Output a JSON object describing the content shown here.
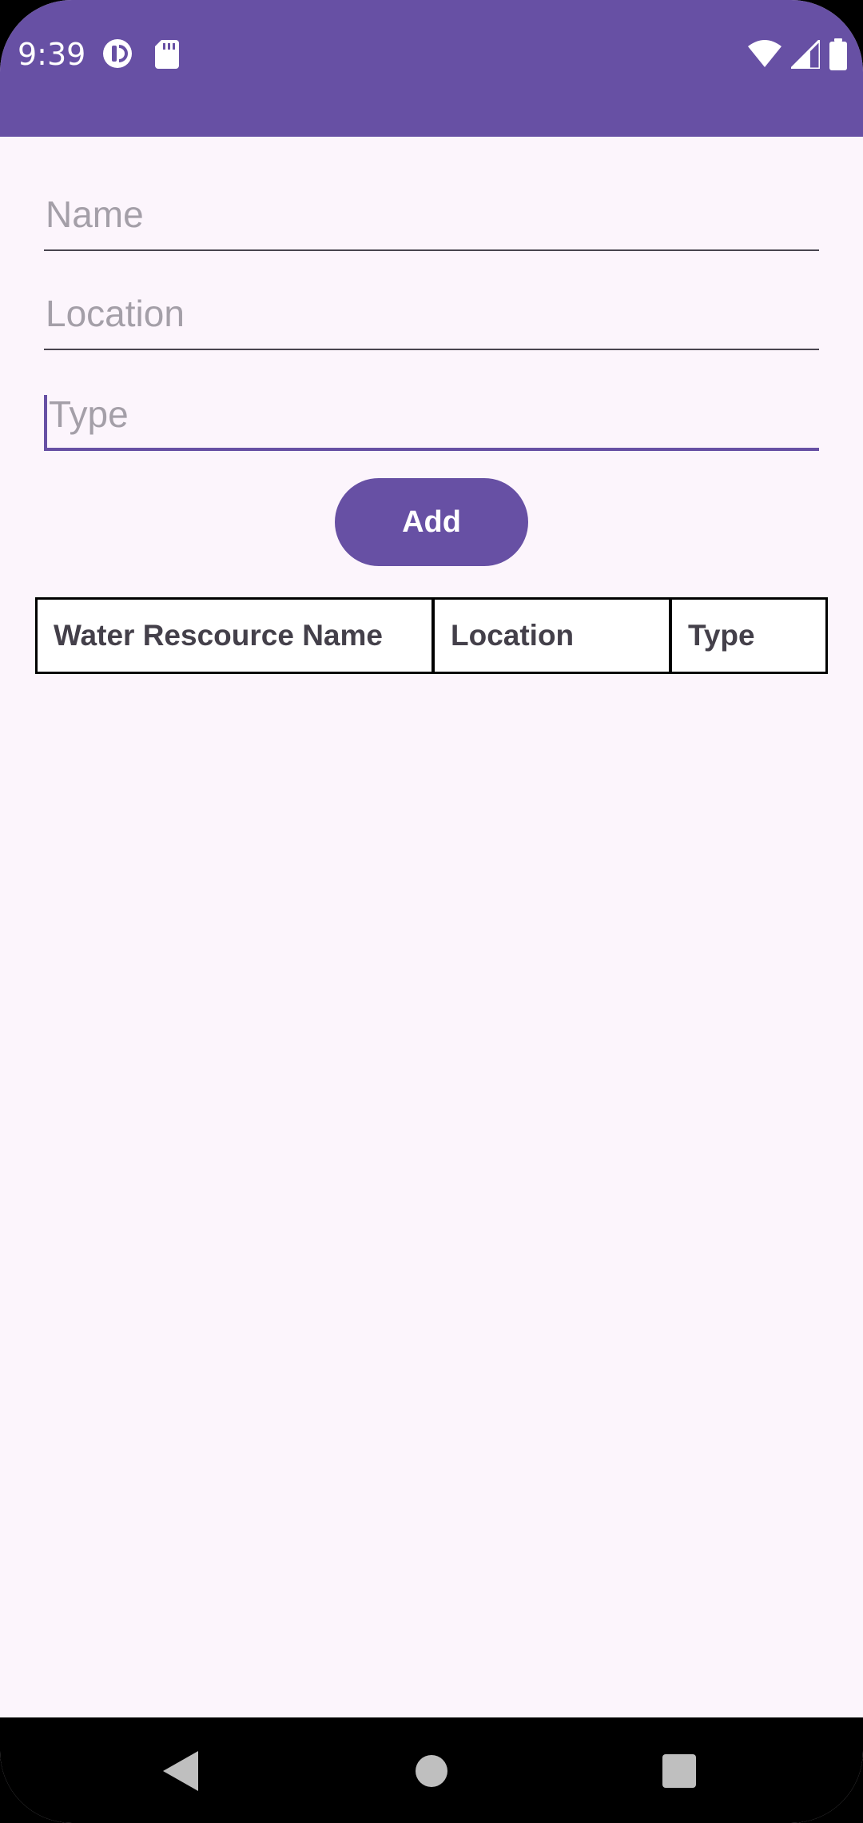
{
  "status_bar": {
    "time": "9:39",
    "icons_left": [
      "app-notification-icon",
      "sd-card-icon"
    ],
    "icons_right": [
      "wifi-icon",
      "cellular-signal-icon",
      "battery-icon"
    ]
  },
  "form": {
    "name_placeholder": "Name",
    "location_placeholder": "Location",
    "type_placeholder": "Type",
    "add_label": "Add"
  },
  "table": {
    "headers": [
      "Water Rescource Name",
      "Location",
      "Type"
    ],
    "rows": []
  },
  "nav_bar": {
    "icons": [
      "back-icon",
      "home-icon",
      "recents-icon"
    ]
  },
  "colors": {
    "primary": "#6750A4",
    "background": "#FCF5FC",
    "placeholder": "#A49FA8"
  }
}
